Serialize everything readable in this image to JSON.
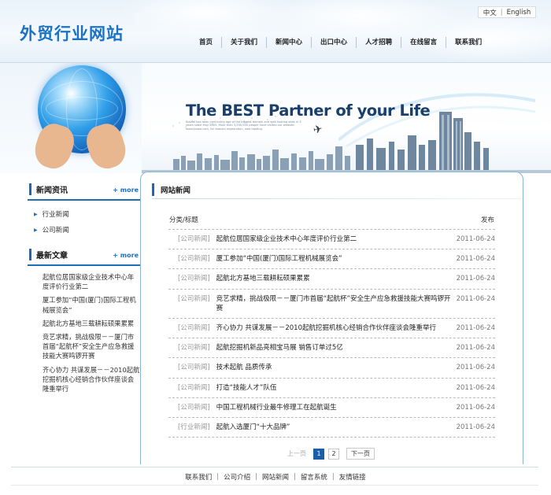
{
  "header": {
    "logo_text": "外贸行业网站",
    "lang": {
      "zh": "中文",
      "sep": "|",
      "en": "English"
    },
    "nav": [
      "首页",
      "关于我们",
      "新闻中心",
      "出口中心",
      "人才招聘",
      "在线留言",
      "联系我们"
    ]
  },
  "banner": {
    "tagline": "The BEST Partner of your Life",
    "subtext": "Kiaolai has been continuing one of the biggest domain and web hosting sites in 3 years since May 2005. More than 3,500,000 people have visited our website. www.ksaoo.com, for domain registration, web hosting."
  },
  "sidebar": {
    "news_title": "新闻资讯",
    "more": "+ more",
    "categories": [
      "行业新闻",
      "公司新闻"
    ],
    "latest_title": "最新文章",
    "articles": [
      "起航位居国家级企业技术中心年度评价行业第二",
      "厦工参加“中国(厦门)国际工程机械展览会”",
      "起航北方基地三载耕耘硕果累累",
      "竞艺求精，挑战极限－－厦门市首届“起航杯”安全生产应急救援技能大赛鸣锣开赛",
      "齐心协力 共谋发展－－2010起航挖掘机核心经销合作伙伴座谈会隆重举行"
    ]
  },
  "main": {
    "title": "网站新闻",
    "col_left": "分类/标题",
    "col_right": "发布",
    "rows": [
      {
        "cat": "[公司新闻]",
        "title": "起航位居国家级企业技术中心年度评价行业第二",
        "date": "2011-06-24"
      },
      {
        "cat": "[公司新闻]",
        "title": "厦工参加“中国(厦门)国际工程机械展览会”",
        "date": "2011-06-24"
      },
      {
        "cat": "[公司新闻]",
        "title": "起航北方基地三载耕耘硕果累累",
        "date": "2011-06-24"
      },
      {
        "cat": "[公司新闻]",
        "title": "竞艺求精，挑战极限－－厦门市首届“起航杯”安全生产应急救援技能大赛鸣锣开赛",
        "date": "2011-06-24"
      },
      {
        "cat": "[公司新闻]",
        "title": "齐心协力 共谋发展－－2010起航挖掘机核心经销合作伙伴座谈会隆重举行",
        "date": "2011-06-24"
      },
      {
        "cat": "[公司新闻]",
        "title": "起航挖掘机新品亮相宝马展 销售订单过5亿",
        "date": "2011-06-24"
      },
      {
        "cat": "[公司新闻]",
        "title": "技术起航 品质传承",
        "date": "2011-06-24"
      },
      {
        "cat": "[公司新闻]",
        "title": "打造“技能人才”队伍",
        "date": "2011-06-24"
      },
      {
        "cat": "[公司新闻]",
        "title": "中国工程机械行业最牛修理工在起航诞生",
        "date": "2011-06-24"
      },
      {
        "cat": "[行业新闻]",
        "title": "起航入选厦门“十大品牌”",
        "date": "2011-06-24"
      }
    ],
    "pager": {
      "prev": "上一页",
      "page1": "1",
      "page2": "2",
      "next": "下一页"
    }
  },
  "footer": {
    "links": [
      "联系我们",
      "公司介绍",
      "网站新闻",
      "留言系统",
      "友情链接"
    ],
    "sep": "|"
  },
  "colors": {
    "brand": "#1a72c6",
    "accent_bar": "#1a68b8",
    "border": "#8bb4d6"
  }
}
